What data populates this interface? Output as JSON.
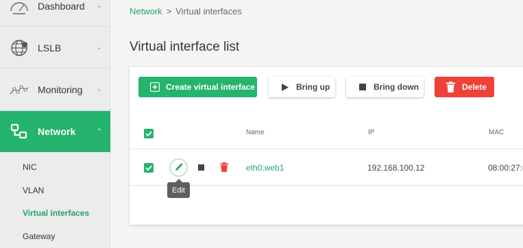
{
  "sidebar": {
    "items": [
      {
        "label": "Dashboard",
        "icon": "gauge-icon"
      },
      {
        "label": "LSLB",
        "icon": "globe-icon"
      },
      {
        "label": "Monitoring",
        "icon": "monitoring-icon"
      },
      {
        "label": "Network",
        "icon": "network-icon",
        "active": true
      }
    ],
    "sub_items": [
      {
        "label": "NIC"
      },
      {
        "label": "VLAN"
      },
      {
        "label": "Virtual interfaces",
        "active": true
      },
      {
        "label": "Gateway"
      }
    ],
    "active_color": "#24b46d"
  },
  "breadcrumb": {
    "parent": "Network",
    "separator": ">",
    "current": "Virtual interfaces"
  },
  "page": {
    "title": "Virtual interface list"
  },
  "toolbar": {
    "create_label": "Create virtual interface",
    "bring_up_label": "Bring up",
    "bring_down_label": "Bring down",
    "delete_label": "Delete",
    "create_color": "#24b46d",
    "delete_color": "#ef4138"
  },
  "table": {
    "columns": [
      "Name",
      "IP",
      "MAC"
    ],
    "rows": [
      {
        "name": "eth0:web1",
        "ip": "192.168.100.12",
        "mac": "08:00:27:c",
        "checked": true
      }
    ],
    "all_checked": true
  },
  "tooltip": {
    "text": "Edit"
  }
}
